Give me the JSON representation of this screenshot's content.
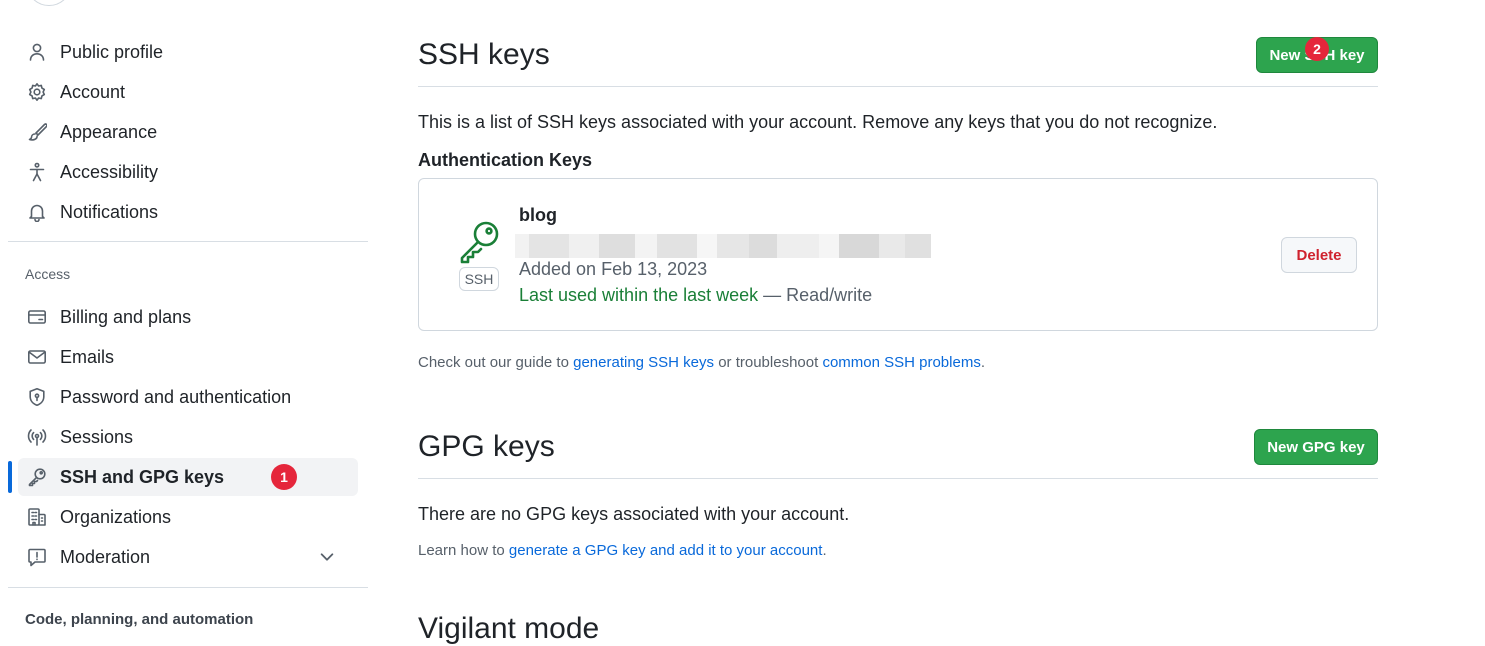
{
  "sidebar": {
    "top_items": [
      {
        "label": "Public profile",
        "icon": "person-icon"
      },
      {
        "label": "Account",
        "icon": "gear-icon"
      },
      {
        "label": "Appearance",
        "icon": "paintbrush-icon"
      },
      {
        "label": "Accessibility",
        "icon": "accessibility-icon"
      },
      {
        "label": "Notifications",
        "icon": "bell-icon"
      }
    ],
    "access_title": "Access",
    "access_items": [
      {
        "label": "Billing and plans",
        "icon": "credit-card-icon"
      },
      {
        "label": "Emails",
        "icon": "mail-icon"
      },
      {
        "label": "Password and authentication",
        "icon": "shield-lock-icon"
      },
      {
        "label": "Sessions",
        "icon": "broadcast-icon"
      },
      {
        "label": "SSH and GPG keys",
        "icon": "key-icon",
        "active": true,
        "badge": "1"
      },
      {
        "label": "Organizations",
        "icon": "organization-icon"
      },
      {
        "label": "Moderation",
        "icon": "report-icon",
        "expandable": true
      }
    ],
    "code_title": "Code, planning, and automation"
  },
  "ssh": {
    "title": "SSH keys",
    "new_button": "New SSH key",
    "new_button_badge": "2",
    "description": "This is a list of SSH keys associated with your account. Remove any keys that you do not recognize.",
    "auth_title": "Authentication Keys",
    "key": {
      "title": "blog",
      "type_tag": "SSH",
      "added": "Added on Feb 13, 2023",
      "last_used": "Last used within the last week",
      "access": " — Read/write",
      "delete": "Delete"
    },
    "guide_prefix": "Check out our guide to ",
    "guide_link1": "generating SSH keys",
    "guide_mid": " or troubleshoot ",
    "guide_link2": "common SSH problems",
    "guide_suffix": "."
  },
  "gpg": {
    "title": "GPG keys",
    "new_button": "New GPG key",
    "empty": "There are no GPG keys associated with your account.",
    "learn_prefix": "Learn how to ",
    "learn_link": "generate a GPG key and add it to your account",
    "learn_suffix": "."
  },
  "vigilant": {
    "title": "Vigilant mode"
  },
  "colors": {
    "accent": "#0969da",
    "green": "#2da44e",
    "danger": "#cf222e",
    "badge": "#e5263b"
  }
}
